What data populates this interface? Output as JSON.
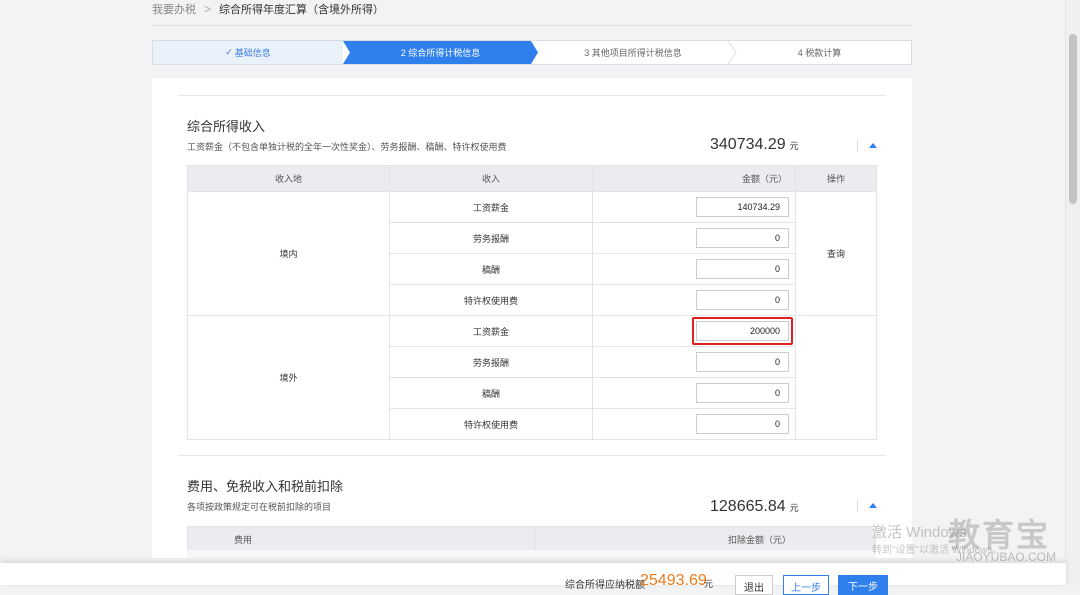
{
  "breadcrumb": {
    "home": "我要办税",
    "sep": ">",
    "current": "综合所得年度汇算（含境外所得）"
  },
  "steps": [
    {
      "label": "基础信息",
      "check": "✓"
    },
    {
      "label": "2  综合所得计税信息"
    },
    {
      "label": "3  其他项目所得计税信息"
    },
    {
      "label": "4  税款计算"
    }
  ],
  "income_section": {
    "title": "综合所得收入",
    "subtitle": "工资薪金（不包含单独计税的全年一次性奖金）、劳务报酬、稿酬、特许权使用费",
    "total": "340734.29",
    "unit": "元",
    "headers": {
      "region": "收入地",
      "type": "收入",
      "amount": "金额（元）",
      "op": "操作"
    },
    "domestic": {
      "region": "境内",
      "op_label": "查询",
      "rows": [
        {
          "type": "工资薪金",
          "amount": "140734.29"
        },
        {
          "type": "劳务报酬",
          "amount": "0"
        },
        {
          "type": "稿酬",
          "amount": "0"
        },
        {
          "type": "特许权使用费",
          "amount": "0"
        }
      ]
    },
    "foreign": {
      "region": "境外",
      "rows": [
        {
          "type": "工资薪金",
          "amount": "200000"
        },
        {
          "type": "劳务报酬",
          "amount": "0"
        },
        {
          "type": "稿酬",
          "amount": "0"
        },
        {
          "type": "特许权使用费",
          "amount": "0"
        }
      ]
    }
  },
  "expense_section": {
    "title": "费用、免税收入和税前扣除",
    "subtitle": "各项按政策规定可在税前扣除的项目",
    "total": "128665.84",
    "unit": "元",
    "headers": {
      "item": "费用",
      "amount": "扣除金额（元）"
    }
  },
  "footer": {
    "tax_label": "综合所得应纳税额",
    "tax_value": "25493.69",
    "tax_unit": "元",
    "exit_label": "退出",
    "prev_label": "上一步",
    "next_label": "下一步"
  },
  "watermark": {
    "line1": "激活 Windows",
    "line2": "转到\"设置\"以激活 Windows。",
    "logo": "教育宝",
    "url": "JIAOYUBAO.COM"
  },
  "colors": {
    "accent": "#2f80ed",
    "highlight": "#e02020",
    "tax": "#f07a1a"
  }
}
